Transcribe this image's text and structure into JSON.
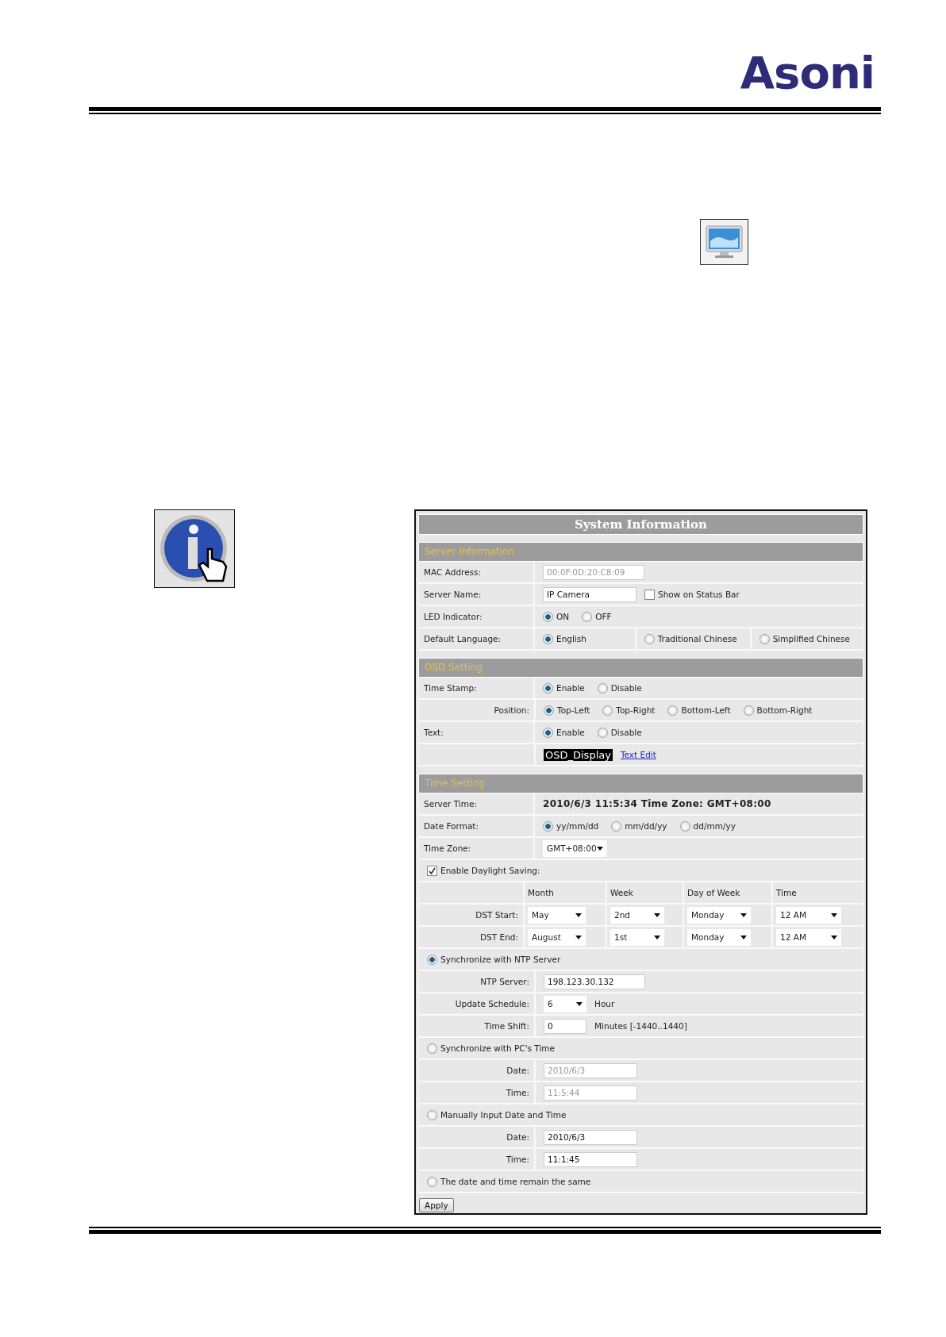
{
  "logo": "Asoni",
  "panel": {
    "title": "System Information",
    "sections": [
      {
        "title": "Server Information",
        "rows": [
          {
            "kind": "field",
            "label": "MAC Address:",
            "items": [
              {
                "kind": "input",
                "value": "00:0F:0D:20:C8:09",
                "disabled": true
              }
            ]
          },
          {
            "kind": "field",
            "label": "Server Name:",
            "items": [
              {
                "kind": "input",
                "value": "IP Camera",
                "disabled": false
              },
              {
                "kind": "checkbox",
                "label": "Show on Status Bar",
                "checked": false
              }
            ]
          },
          {
            "kind": "field",
            "label": "LED Indicator:",
            "items": [
              {
                "kind": "radio",
                "label": "ON",
                "selected": true
              },
              {
                "kind": "radio",
                "label": "OFF",
                "selected": false
              }
            ]
          },
          {
            "kind": "split",
            "label": "Default Language:",
            "items": [
              {
                "kind": "radio",
                "label": "English",
                "selected": true
              },
              {
                "kind": "radio",
                "label": "Traditional Chinese",
                "selected": false
              },
              {
                "kind": "radio",
                "label": "Simplified Chinese",
                "selected": false
              }
            ]
          }
        ]
      },
      {
        "title": "OSD Setting",
        "rows": [
          {
            "kind": "field",
            "label": "Time Stamp:",
            "items": [
              {
                "kind": "radio",
                "label": "Enable",
                "selected": true
              },
              {
                "kind": "radio",
                "label": "Disable",
                "selected": false
              }
            ]
          },
          {
            "kind": "sub",
            "label": "Position:",
            "items": [
              {
                "kind": "radio",
                "label": "Top-Left",
                "selected": true
              },
              {
                "kind": "radio",
                "label": "Top-Right",
                "selected": false
              },
              {
                "kind": "radio",
                "label": "Bottom-Left",
                "selected": false
              },
              {
                "kind": "radio",
                "label": "Bottom-Right",
                "selected": false
              }
            ]
          },
          {
            "kind": "field",
            "label": "Text:",
            "items": [
              {
                "kind": "radio",
                "label": "Enable",
                "selected": true
              },
              {
                "kind": "radio",
                "label": "Disable",
                "selected": false
              }
            ]
          },
          {
            "kind": "sub",
            "items": [
              {
                "kind": "osd",
                "text": "OSD_Display"
              },
              {
                "kind": "link",
                "text": "Text Edit"
              }
            ]
          }
        ]
      },
      {
        "title": "Time Setting",
        "rows": [
          {
            "kind": "field",
            "label": "Server Time:",
            "items": [
              {
                "kind": "text",
                "text": "2010/6/3 11:5:34 Time Zone: GMT+08:00",
                "bold": true
              }
            ]
          },
          {
            "kind": "field",
            "label": "Date Format:",
            "items": [
              {
                "kind": "radio",
                "label": "yy/mm/dd",
                "selected": true
              },
              {
                "kind": "radio",
                "label": "mm/dd/yy",
                "selected": false
              },
              {
                "kind": "radio",
                "label": "dd/mm/yy",
                "selected": false
              }
            ]
          },
          {
            "kind": "field",
            "label": "Time Zone:",
            "items": [
              {
                "kind": "select",
                "value": "GMT+08:00"
              }
            ]
          },
          {
            "kind": "option",
            "items": [
              {
                "kind": "checkbox",
                "label": "Enable Daylight Saving:",
                "checked": true
              }
            ]
          },
          {
            "kind": "grid",
            "columns": [
              "Month",
              "Week",
              "Day of Week",
              "Time"
            ],
            "rows": [
              {
                "label": "DST Start:",
                "values": [
                  "May",
                  "2nd",
                  "Monday",
                  "12 AM"
                ]
              },
              {
                "label": "DST End:",
                "values": [
                  "August",
                  "1st",
                  "Monday",
                  "12 AM"
                ]
              }
            ]
          },
          {
            "kind": "option",
            "items": [
              {
                "kind": "radio",
                "label": "Synchronize with NTP Server",
                "selected": true
              }
            ]
          },
          {
            "kind": "sub",
            "label": "NTP Server:",
            "items": [
              {
                "kind": "input",
                "value": "198.123.30.132",
                "disabled": false
              }
            ]
          },
          {
            "kind": "sub",
            "label": "Update Schedule:",
            "items": [
              {
                "kind": "select",
                "value": "6"
              },
              {
                "kind": "text",
                "text": "Hour",
                "bold": false
              }
            ]
          },
          {
            "kind": "sub",
            "label": "Time Shift:",
            "items": [
              {
                "kind": "input",
                "value": "0",
                "disabled": false
              },
              {
                "kind": "text",
                "text": "Minutes  [-1440..1440]",
                "bold": false
              }
            ]
          },
          {
            "kind": "option",
            "items": [
              {
                "kind": "radio",
                "label": "Synchronize with PC's Time",
                "selected": false
              }
            ]
          },
          {
            "kind": "sub",
            "label": "Date:",
            "items": [
              {
                "kind": "input",
                "value": "2010/6/3",
                "disabled": true
              }
            ]
          },
          {
            "kind": "sub",
            "label": "Time:",
            "items": [
              {
                "kind": "input",
                "value": "11:5:44",
                "disabled": true
              }
            ]
          },
          {
            "kind": "option",
            "items": [
              {
                "kind": "radio",
                "label": "Manually Input Date and Time",
                "selected": false
              }
            ]
          },
          {
            "kind": "sub",
            "label": "Date:",
            "items": [
              {
                "kind": "input",
                "value": "2010/6/3",
                "disabled": false
              }
            ]
          },
          {
            "kind": "sub",
            "label": "Time:",
            "items": [
              {
                "kind": "input",
                "value": "11:1:45",
                "disabled": false
              }
            ]
          },
          {
            "kind": "option",
            "items": [
              {
                "kind": "radio",
                "label": "The date and time remain the same",
                "selected": false
              }
            ]
          }
        ]
      }
    ],
    "apply_button": "Apply"
  }
}
